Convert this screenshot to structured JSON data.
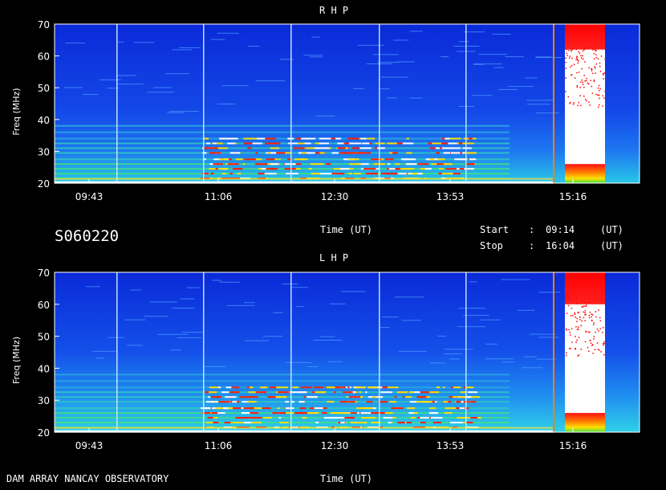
{
  "chart_data": [
    {
      "type": "heatmap",
      "title": "R H P",
      "ylabel": "Freq (MHz)",
      "xlabel": "Time (UT)",
      "ylim": [
        20,
        70
      ],
      "yticks": [
        "20",
        "30",
        "40",
        "50",
        "60",
        "70"
      ],
      "xticks": [
        "09:43",
        "11:06",
        "12:30",
        "13:53",
        "15:16"
      ]
    },
    {
      "type": "heatmap",
      "title": "L H P",
      "ylabel": "Freq (MHz)",
      "xlabel": "Time (UT)",
      "ylim": [
        20,
        70
      ],
      "yticks": [
        "20",
        "30",
        "40",
        "50",
        "60",
        "70"
      ],
      "xticks": [
        "09:43",
        "11:06",
        "12:30",
        "13:53",
        "15:16"
      ]
    }
  ],
  "station": "S060220",
  "mid_time_label": "Time (UT)",
  "start": {
    "label": "Start",
    "sep": ":",
    "time": "09:14",
    "unit": "(UT)"
  },
  "stop": {
    "label": "Stop",
    "sep": ":",
    "time": "16:04",
    "unit": "(UT)"
  },
  "footer": "DAM ARRAY  NANCAY OBSERVATORY",
  "colors": {
    "background": "#000000",
    "low": "#1030e0",
    "high": "#ff0000",
    "saturated": "#ffffff"
  }
}
